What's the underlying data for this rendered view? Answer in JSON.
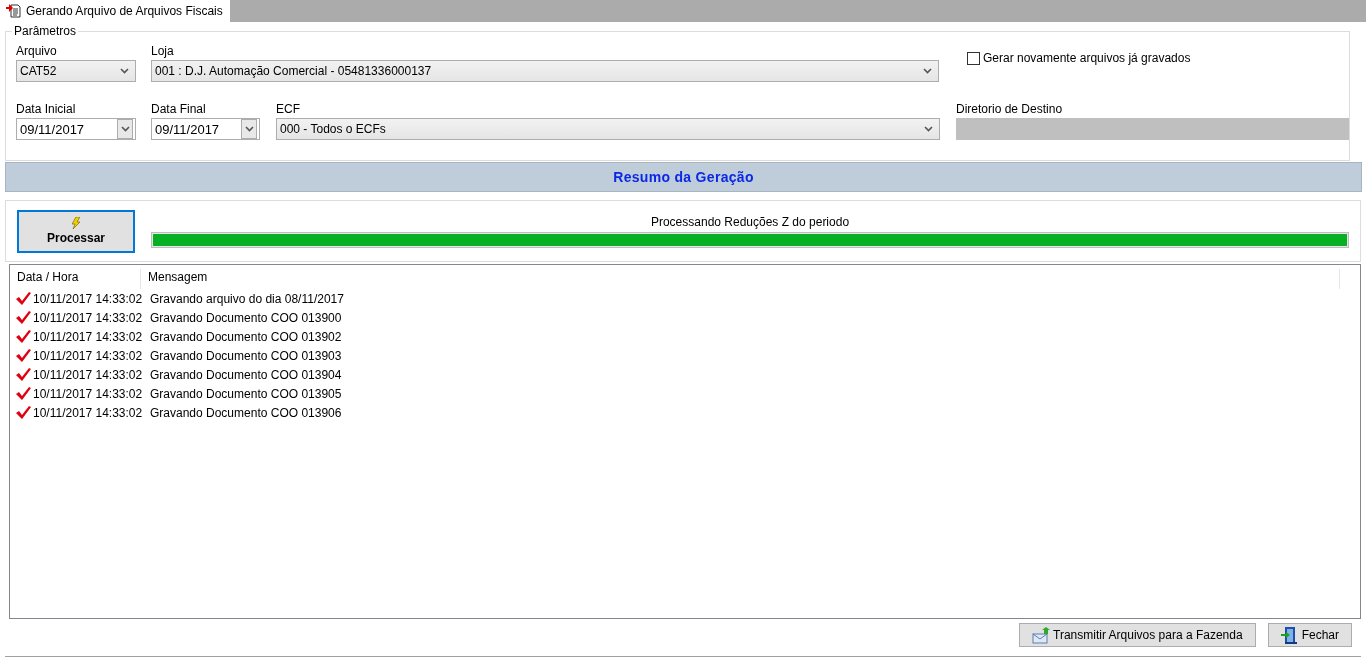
{
  "tab": {
    "title": "Gerando Arquivo de Arquivos Fiscais",
    "selected": true
  },
  "parameters": {
    "legend": "Parâmetros",
    "arquivo": {
      "label": "Arquivo",
      "value": "CAT52"
    },
    "loja": {
      "label": "Loja",
      "value": "001 : D.J. Automação Comercial - 05481336000137"
    },
    "regenerate": {
      "label": "Gerar novamente arquivos já gravados",
      "checked": false
    },
    "data_inicial": {
      "label": "Data Inicial",
      "value": "09/11/2017"
    },
    "data_final": {
      "label": "Data Final",
      "value": "09/11/2017"
    },
    "ecf": {
      "label": "ECF",
      "value": "000 - Todos o ECFs"
    },
    "diretorio": {
      "label": "Diretorio de Destino",
      "disabled": true
    }
  },
  "summary": {
    "title": "Resumo da Geração"
  },
  "process": {
    "button": "Processar",
    "status": "Processando Reduções Z do periodo",
    "level": 1
  },
  "log": {
    "columns": [
      "Data / Hora",
      "Mensagem"
    ],
    "rows": [
      {
        "kind": "success",
        "datetime": "10/11/2017 14:33:02",
        "message": "Gravando arquivo do dia 08/11/2017"
      },
      {
        "kind": "success",
        "datetime": "10/11/2017 14:33:02",
        "message": "Gravando Documento COO 013900"
      },
      {
        "kind": "success",
        "datetime": "10/11/2017 14:33:02",
        "message": "Gravando Documento COO 013902"
      },
      {
        "kind": "success",
        "datetime": "10/11/2017 14:33:02",
        "message": "Gravando Documento COO 013903"
      },
      {
        "kind": "success",
        "datetime": "10/11/2017 14:33:02",
        "message": "Gravando Documento COO 013904"
      },
      {
        "kind": "success",
        "datetime": "10/11/2017 14:33:02",
        "message": "Gravando Documento COO 013905"
      },
      {
        "kind": "success",
        "datetime": "10/11/2017 14:33:02",
        "message": "Gravando Documento COO 013906"
      }
    ]
  },
  "buttons": [
    {
      "kind": "transmit",
      "label": "Transmitir Arquivos para a Fazenda"
    },
    {
      "kind": "close",
      "label": "Fechar"
    }
  ]
}
